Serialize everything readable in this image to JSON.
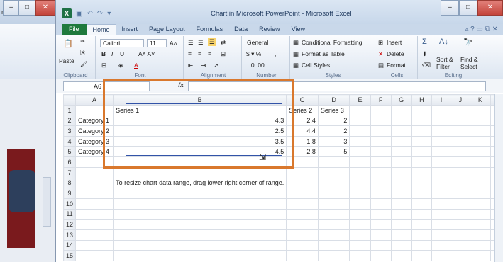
{
  "ppt": {
    "ribbon_text": "rmat",
    "paste_label": "Paste",
    "clipboard_label": "Clipboard"
  },
  "window": {
    "title": "Chart in Microsoft PowerPoint - Microsoft Excel"
  },
  "tabs": [
    "File",
    "Home",
    "Insert",
    "Page Layout",
    "Formulas",
    "Data",
    "Review",
    "View"
  ],
  "ribbon": {
    "font": {
      "name": "Calibri",
      "size": "11",
      "label": "Font"
    },
    "alignment_label": "Alignment",
    "number": {
      "format": "General",
      "label": "Number"
    },
    "styles": {
      "conditional": "Conditional Formatting",
      "table": "Format as Table",
      "cell": "Cell Styles",
      "label": "Styles"
    },
    "cells": {
      "insert": "Insert",
      "delete": "Delete",
      "format": "Format",
      "label": "Cells"
    },
    "editing": {
      "sort": "Sort &",
      "filter": "Filter",
      "find": "Find &",
      "select": "Select",
      "label": "Editing"
    }
  },
  "formula_bar": {
    "name_box": "A6",
    "fx": "fx"
  },
  "columns": [
    "A",
    "B",
    "C",
    "D",
    "E",
    "F",
    "G",
    "H",
    "I",
    "J",
    "K",
    "L"
  ],
  "rows": [
    {
      "n": "1",
      "cells": [
        "",
        "Series 1",
        "Series 2",
        "Series 3"
      ]
    },
    {
      "n": "2",
      "cells": [
        "Category 1",
        "4.3",
        "2.4",
        "2"
      ]
    },
    {
      "n": "3",
      "cells": [
        "Category 2",
        "2.5",
        "4.4",
        "2"
      ]
    },
    {
      "n": "4",
      "cells": [
        "Category 3",
        "3.5",
        "1.8",
        "3"
      ]
    },
    {
      "n": "5",
      "cells": [
        "Category 4",
        "4.5",
        "2.8",
        "5"
      ]
    },
    {
      "n": "6",
      "cells": [
        "",
        "",
        "",
        ""
      ]
    },
    {
      "n": "7",
      "cells": [
        "",
        "",
        "",
        ""
      ]
    },
    {
      "n": "8",
      "cells": [
        "",
        "",
        "",
        ""
      ],
      "note": "To resize chart data range, drag lower right corner of range."
    },
    {
      "n": "9",
      "cells": [
        "",
        "",
        "",
        ""
      ]
    },
    {
      "n": "10",
      "cells": [
        "",
        "",
        "",
        ""
      ]
    },
    {
      "n": "11",
      "cells": [
        "",
        "",
        "",
        ""
      ]
    },
    {
      "n": "12",
      "cells": [
        "",
        "",
        "",
        ""
      ]
    },
    {
      "n": "13",
      "cells": [
        "",
        "",
        "",
        ""
      ]
    },
    {
      "n": "14",
      "cells": [
        "",
        "",
        "",
        ""
      ]
    },
    {
      "n": "15",
      "cells": [
        "",
        "",
        "",
        ""
      ]
    }
  ]
}
